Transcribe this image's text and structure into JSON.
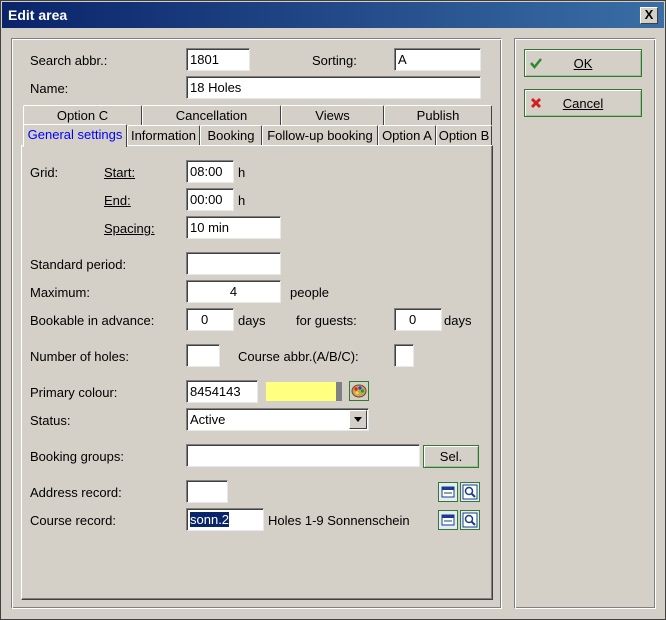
{
  "window": {
    "title": "Edit area",
    "close_label": "X"
  },
  "header": {
    "search_abbr_label": "Search abbr.:",
    "search_abbr_value": "1801",
    "sorting_label": "Sorting:",
    "sorting_value": "A",
    "name_label": "Name:",
    "name_value": "18 Holes"
  },
  "tabs": {
    "row1": [
      "Option C",
      "Cancellation",
      "Views",
      "Publish"
    ],
    "row2": [
      "General settings",
      "Information",
      "Booking",
      "Follow-up booking",
      "Option A",
      "Option B"
    ],
    "active": "General settings"
  },
  "general": {
    "grid_label": "Grid:",
    "start_label": "Start:",
    "start_value": "08:00",
    "end_label": "End:",
    "end_value": "00:00",
    "hour_unit": "h",
    "spacing_label": "Spacing:",
    "spacing_value": "10 min",
    "standard_period_label": "Standard period:",
    "standard_period_value": "",
    "maximum_label": "Maximum:",
    "maximum_value": "4",
    "maximum_unit": "people",
    "bookable_label": "Bookable in advance:",
    "bookable_value": "0",
    "days_unit": "days",
    "guests_label": "for guests:",
    "guests_value": "0",
    "holes_label": "Number of holes:",
    "holes_value": "",
    "course_abbr_label": "Course abbr.(A/B/C):",
    "course_abbr_value": "",
    "primary_colour_label": "Primary colour:",
    "primary_colour_value": "8454143",
    "primary_colour_swatch": "#ffff80",
    "status_label": "Status:",
    "status_value": "Active",
    "booking_groups_label": "Booking groups:",
    "booking_groups_value": "",
    "sel_label": "Sel.",
    "address_record_label": "Address record:",
    "address_record_value": "",
    "course_record_label": "Course record:",
    "course_record_value": "sonn.2",
    "course_record_desc": "Holes 1-9 Sonnenschein"
  },
  "actions": {
    "ok_label": "OK",
    "cancel_label": "Cancel"
  },
  "icons": {
    "ok": "checkmark-icon",
    "cancel": "red-x-icon",
    "palette": "palette-icon",
    "edit": "edit-record-icon",
    "search": "search-record-icon"
  }
}
